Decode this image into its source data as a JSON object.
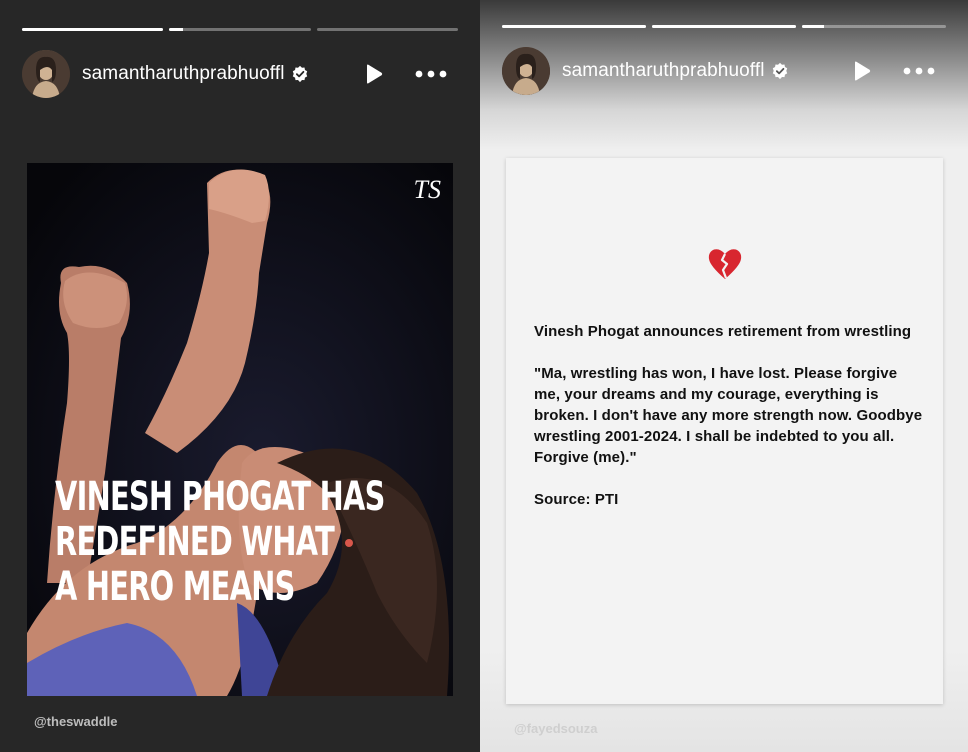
{
  "left_story": {
    "progress": [
      1.0,
      0.1,
      0.0
    ],
    "username": "samantharuthprabhuoffl",
    "headline_lines": [
      "VINESH PHOGAT HAS",
      "REDEFINED WHAT",
      "A HERO MEANS"
    ],
    "logo_text": "TS",
    "credit": "@theswaddle"
  },
  "right_story": {
    "progress": [
      1.0,
      1.0,
      0.15
    ],
    "username": "samantharuthprabhuoffl",
    "heading": "Vinesh Phogat announces retirement from wrestling",
    "quote": "\"Ma, wrestling has won, I have lost. Please forgive me, your dreams and my courage, everything is broken. I don't have any more strength now. Goodbye wrestling 2001-2024. I shall be indebted to you all. Forgive (me).\"",
    "source": "Source: PTI",
    "credit": "@fayedsouza",
    "emoji_icon": "broken-heart-icon"
  },
  "colors": {
    "left_bg": "#272727",
    "right_card_bg": "#f3f3f3",
    "verified_badge": "#ffffff",
    "heart_red": "#d8262f"
  }
}
